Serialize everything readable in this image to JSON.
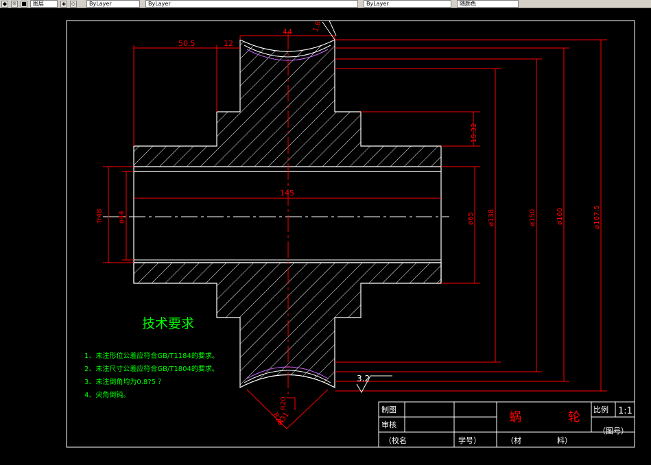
{
  "toolbar": {
    "layer_label": "图层",
    "combo1": "ByLayer",
    "combo2": "ByLayer",
    "combo3": "ByLayer",
    "combo4": "随颜色"
  },
  "drawing": {
    "dimensions": {
      "d_50_5": "50.5",
      "d_12": "12",
      "d_44": "44",
      "d_1_6": "1.6",
      "d_15_32": "15.32",
      "d_145": "145",
      "d_tr48": "Tr48",
      "d_phi44": "ø44",
      "d_phi65": "ø65",
      "d_phi138": "ø138",
      "d_phi150": "ø150",
      "d_phi160": "ø160",
      "d_phi167_5": "ø167.5",
      "d_3_2": "3.2",
      "d_r20": "R20",
      "d_r25": "R25",
      "d_r31": "R31"
    },
    "tech_requirements": {
      "title": "技术要求",
      "items": [
        "1、未注形位公差应符合GB/T1184的要求。",
        "2、未注尺寸公差应符合GB/T1804的要求。",
        "3、未注倒角均为0.8?5 ？",
        "4、尖角倒钝。"
      ]
    },
    "title_block": {
      "drawn_label": "制图",
      "checked_label": "审核",
      "school": "（校名",
      "student_no": "学号）",
      "part_name_1": "蜗",
      "part_name_2": "轮",
      "scale_label": "比例",
      "scale_value": "1:1",
      "drawing_no": "（图号）",
      "material_1": "（材",
      "material_2": "料）"
    }
  },
  "colors": {
    "outline": "#ffffff",
    "dimension": "#ff0000",
    "text_green": "#00ff00",
    "text_red": "#ff0000",
    "pitch_line": "#cc66ff",
    "background": "#000000"
  }
}
